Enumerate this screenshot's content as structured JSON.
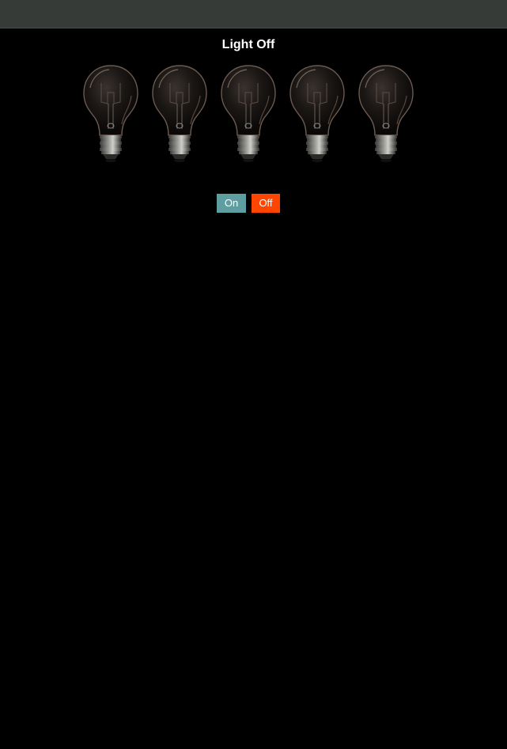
{
  "title": "Light Off",
  "bulbs": [
    {
      "state": "off"
    },
    {
      "state": "off"
    },
    {
      "state": "off"
    },
    {
      "state": "off"
    },
    {
      "state": "off"
    }
  ],
  "buttons": {
    "on_label": "On",
    "off_label": "Off",
    "on_color": "#5f9ea0",
    "off_color": "#ff4500"
  },
  "colors": {
    "top_bar": "#373b37",
    "background": "#000000"
  }
}
